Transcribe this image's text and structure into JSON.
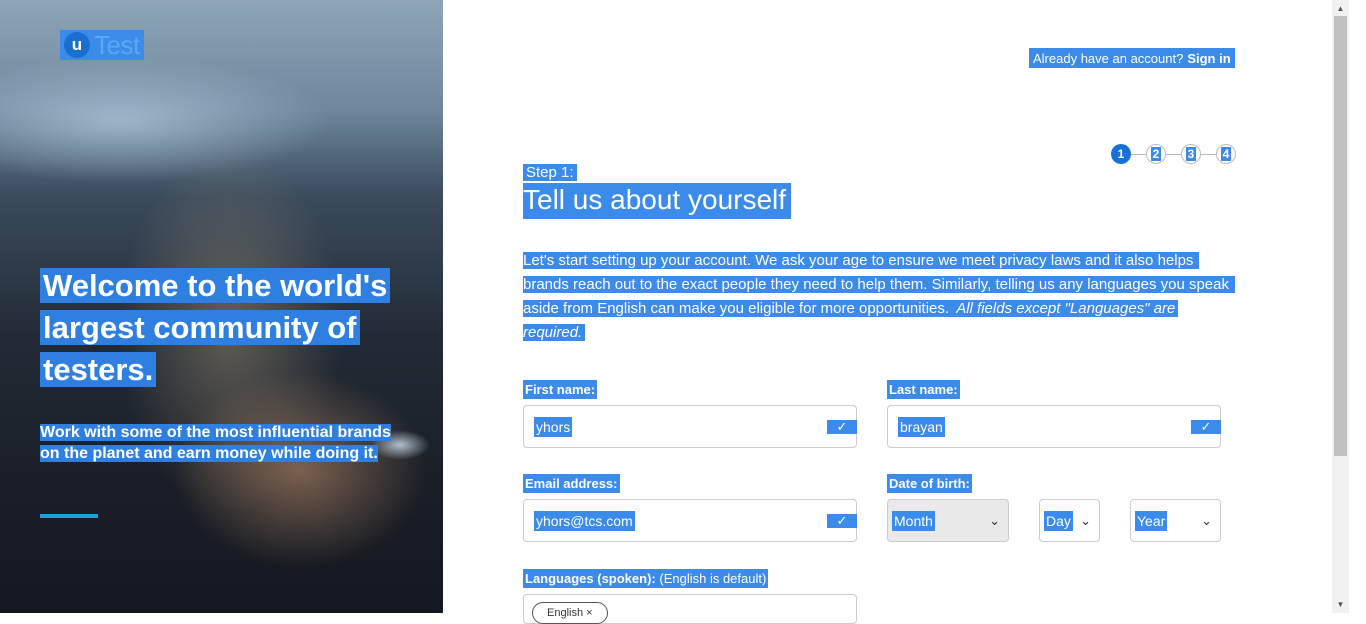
{
  "brand": {
    "logo_mark": "u",
    "logo_text": "Test"
  },
  "hero": {
    "title": "Welcome to the world's largest community of testers.",
    "subtitle": "Work with some of the most influential brands on the planet and earn money while doing it."
  },
  "header": {
    "account_prompt": "Already have an account?",
    "signin_link": "Sign in"
  },
  "progress": {
    "steps": [
      "1",
      "2",
      "3",
      "4"
    ],
    "current_step": 1
  },
  "step": {
    "label": "Step 1:",
    "title": "Tell us about yourself"
  },
  "intro": {
    "text": "Let's start setting up your account. We ask your age to ensure we meet privacy laws and it also helps brands reach out to the exact people they need to help them. Similarly, telling us any languages you speak aside from English can make you eligible for more opportunities. ",
    "emphasis": "All fields except \"Languages\" are required."
  },
  "form": {
    "first_name": {
      "label": "First name:",
      "value": "yhors"
    },
    "last_name": {
      "label": "Last name:",
      "value": "brayan"
    },
    "email": {
      "label": "Email address:",
      "value": "yhors@tcs.com"
    },
    "dob": {
      "label": "Date of birth:",
      "month": "Month",
      "day": "Day",
      "year": "Year"
    },
    "languages": {
      "label": "Languages (spoken):",
      "hint": "(English is default)",
      "chips": [
        "English"
      ]
    }
  },
  "icons": {
    "check": "check-icon",
    "chevron": "chevron-down-icon",
    "chip_remove": "close-icon"
  },
  "colors": {
    "selection": "#3b8beb",
    "accent": "#1771d8",
    "hero_bar": "#1ea0d8"
  }
}
